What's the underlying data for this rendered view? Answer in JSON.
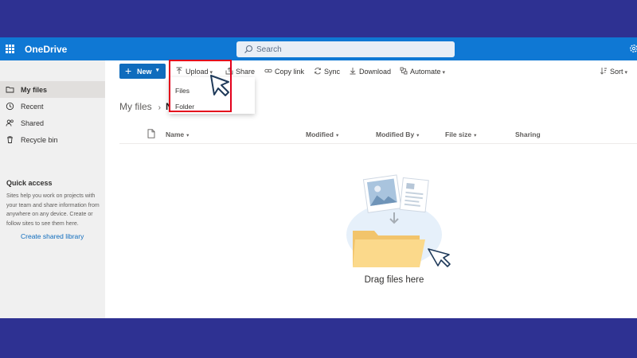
{
  "app": {
    "name": "OneDrive"
  },
  "search": {
    "placeholder": "Search"
  },
  "nav": {
    "items": [
      {
        "label": "My files",
        "icon": "folder-icon",
        "active": true
      },
      {
        "label": "Recent",
        "icon": "clock-icon"
      },
      {
        "label": "Shared",
        "icon": "people-icon"
      },
      {
        "label": "Recycle bin",
        "icon": "trash-icon"
      }
    ],
    "quick_access": {
      "title": "Quick access",
      "description": "Sites help you work on projects with your team and share information from anywhere on any device. Create or follow sites to see them here.",
      "link": "Create shared library"
    }
  },
  "toolbar": {
    "new_label": "New",
    "upload_label": "Upload",
    "share_label": "Share",
    "copy_link_label": "Copy link",
    "sync_label": "Sync",
    "download_label": "Download",
    "automate_label": "Automate",
    "sort_label": "Sort"
  },
  "upload_menu": {
    "options": [
      "Files",
      "Folder"
    ]
  },
  "breadcrumb": {
    "root": "My files",
    "current": "N"
  },
  "columns": [
    "Name",
    "Modified",
    "Modified By",
    "File size",
    "Sharing"
  ],
  "empty_state": {
    "text": "Drag files here"
  },
  "colors": {
    "accent": "#0f6cbd",
    "suitebar": "#0f78d4",
    "frame": "#2e3192",
    "highlight": "#e3001b"
  }
}
